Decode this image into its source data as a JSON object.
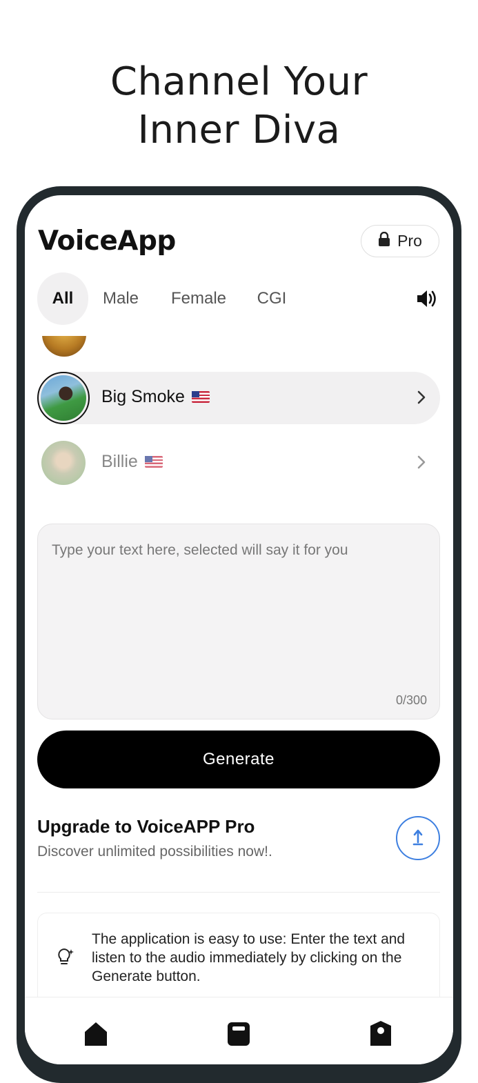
{
  "headline": {
    "line1": "Channel Your",
    "line2": "Inner Diva"
  },
  "header": {
    "app_title": "VoiceApp",
    "pro_label": "Pro"
  },
  "tabs": [
    {
      "label": "All",
      "active": true
    },
    {
      "label": "Male",
      "active": false
    },
    {
      "label": "Female",
      "active": false
    },
    {
      "label": "CGI",
      "active": false
    }
  ],
  "voices": [
    {
      "name": "Big Smoke",
      "flag": "us-flag-icon",
      "selected": true
    },
    {
      "name": "Billie",
      "flag": "us-flag-icon",
      "selected": false
    }
  ],
  "input": {
    "placeholder": "Type your text here, selected will say it for you",
    "counter": "0/300"
  },
  "actions": {
    "generate_label": "Generate"
  },
  "upgrade": {
    "title": "Upgrade to VoiceAPP Pro",
    "subtitle": "Discover unlimited possibilities now!."
  },
  "tip": {
    "text": "The application is easy to use: Enter the text and listen to the audio immediately by clicking on the Generate button."
  },
  "icons": [
    "lock-icon",
    "speaker-icon",
    "chevron-right-icon",
    "upload-icon",
    "lightbulb-icon",
    "home-icon",
    "library-icon",
    "profile-icon"
  ],
  "colors": {
    "accent": "#3d7fe0",
    "primary_button": "#000000",
    "selected_row": "#f1f0f1",
    "frame": "#222a2e"
  }
}
